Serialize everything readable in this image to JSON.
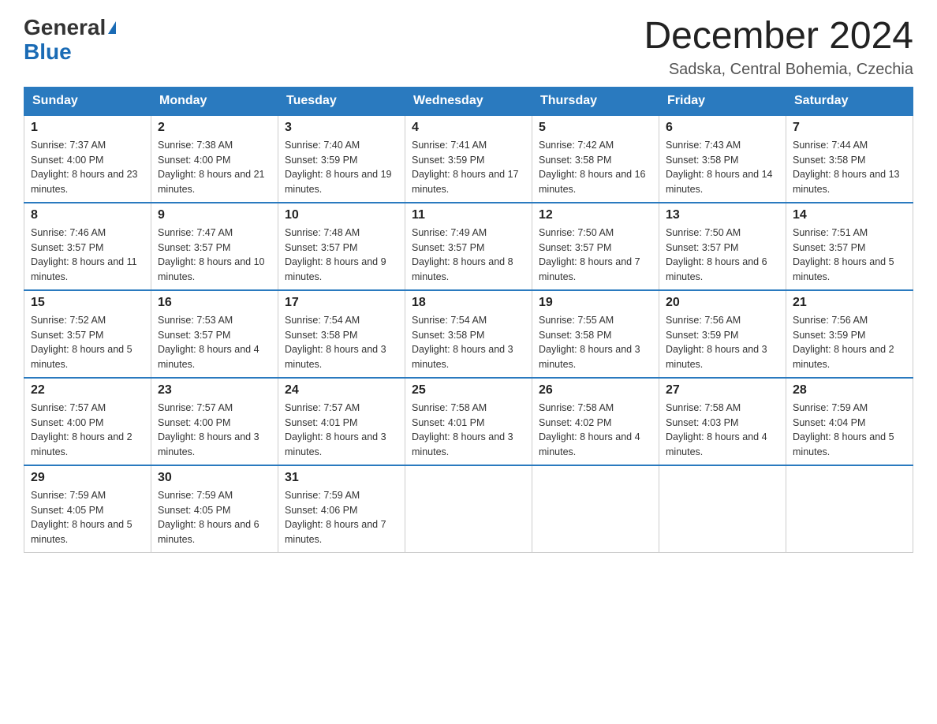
{
  "header": {
    "logo_general": "General",
    "logo_blue": "Blue",
    "month_title": "December 2024",
    "location": "Sadska, Central Bohemia, Czechia"
  },
  "weekdays": [
    "Sunday",
    "Monday",
    "Tuesday",
    "Wednesday",
    "Thursday",
    "Friday",
    "Saturday"
  ],
  "weeks": [
    [
      {
        "day": "1",
        "sunrise": "Sunrise: 7:37 AM",
        "sunset": "Sunset: 4:00 PM",
        "daylight": "Daylight: 8 hours and 23 minutes."
      },
      {
        "day": "2",
        "sunrise": "Sunrise: 7:38 AM",
        "sunset": "Sunset: 4:00 PM",
        "daylight": "Daylight: 8 hours and 21 minutes."
      },
      {
        "day": "3",
        "sunrise": "Sunrise: 7:40 AM",
        "sunset": "Sunset: 3:59 PM",
        "daylight": "Daylight: 8 hours and 19 minutes."
      },
      {
        "day": "4",
        "sunrise": "Sunrise: 7:41 AM",
        "sunset": "Sunset: 3:59 PM",
        "daylight": "Daylight: 8 hours and 17 minutes."
      },
      {
        "day": "5",
        "sunrise": "Sunrise: 7:42 AM",
        "sunset": "Sunset: 3:58 PM",
        "daylight": "Daylight: 8 hours and 16 minutes."
      },
      {
        "day": "6",
        "sunrise": "Sunrise: 7:43 AM",
        "sunset": "Sunset: 3:58 PM",
        "daylight": "Daylight: 8 hours and 14 minutes."
      },
      {
        "day": "7",
        "sunrise": "Sunrise: 7:44 AM",
        "sunset": "Sunset: 3:58 PM",
        "daylight": "Daylight: 8 hours and 13 minutes."
      }
    ],
    [
      {
        "day": "8",
        "sunrise": "Sunrise: 7:46 AM",
        "sunset": "Sunset: 3:57 PM",
        "daylight": "Daylight: 8 hours and 11 minutes."
      },
      {
        "day": "9",
        "sunrise": "Sunrise: 7:47 AM",
        "sunset": "Sunset: 3:57 PM",
        "daylight": "Daylight: 8 hours and 10 minutes."
      },
      {
        "day": "10",
        "sunrise": "Sunrise: 7:48 AM",
        "sunset": "Sunset: 3:57 PM",
        "daylight": "Daylight: 8 hours and 9 minutes."
      },
      {
        "day": "11",
        "sunrise": "Sunrise: 7:49 AM",
        "sunset": "Sunset: 3:57 PM",
        "daylight": "Daylight: 8 hours and 8 minutes."
      },
      {
        "day": "12",
        "sunrise": "Sunrise: 7:50 AM",
        "sunset": "Sunset: 3:57 PM",
        "daylight": "Daylight: 8 hours and 7 minutes."
      },
      {
        "day": "13",
        "sunrise": "Sunrise: 7:50 AM",
        "sunset": "Sunset: 3:57 PM",
        "daylight": "Daylight: 8 hours and 6 minutes."
      },
      {
        "day": "14",
        "sunrise": "Sunrise: 7:51 AM",
        "sunset": "Sunset: 3:57 PM",
        "daylight": "Daylight: 8 hours and 5 minutes."
      }
    ],
    [
      {
        "day": "15",
        "sunrise": "Sunrise: 7:52 AM",
        "sunset": "Sunset: 3:57 PM",
        "daylight": "Daylight: 8 hours and 5 minutes."
      },
      {
        "day": "16",
        "sunrise": "Sunrise: 7:53 AM",
        "sunset": "Sunset: 3:57 PM",
        "daylight": "Daylight: 8 hours and 4 minutes."
      },
      {
        "day": "17",
        "sunrise": "Sunrise: 7:54 AM",
        "sunset": "Sunset: 3:58 PM",
        "daylight": "Daylight: 8 hours and 3 minutes."
      },
      {
        "day": "18",
        "sunrise": "Sunrise: 7:54 AM",
        "sunset": "Sunset: 3:58 PM",
        "daylight": "Daylight: 8 hours and 3 minutes."
      },
      {
        "day": "19",
        "sunrise": "Sunrise: 7:55 AM",
        "sunset": "Sunset: 3:58 PM",
        "daylight": "Daylight: 8 hours and 3 minutes."
      },
      {
        "day": "20",
        "sunrise": "Sunrise: 7:56 AM",
        "sunset": "Sunset: 3:59 PM",
        "daylight": "Daylight: 8 hours and 3 minutes."
      },
      {
        "day": "21",
        "sunrise": "Sunrise: 7:56 AM",
        "sunset": "Sunset: 3:59 PM",
        "daylight": "Daylight: 8 hours and 2 minutes."
      }
    ],
    [
      {
        "day": "22",
        "sunrise": "Sunrise: 7:57 AM",
        "sunset": "Sunset: 4:00 PM",
        "daylight": "Daylight: 8 hours and 2 minutes."
      },
      {
        "day": "23",
        "sunrise": "Sunrise: 7:57 AM",
        "sunset": "Sunset: 4:00 PM",
        "daylight": "Daylight: 8 hours and 3 minutes."
      },
      {
        "day": "24",
        "sunrise": "Sunrise: 7:57 AM",
        "sunset": "Sunset: 4:01 PM",
        "daylight": "Daylight: 8 hours and 3 minutes."
      },
      {
        "day": "25",
        "sunrise": "Sunrise: 7:58 AM",
        "sunset": "Sunset: 4:01 PM",
        "daylight": "Daylight: 8 hours and 3 minutes."
      },
      {
        "day": "26",
        "sunrise": "Sunrise: 7:58 AM",
        "sunset": "Sunset: 4:02 PM",
        "daylight": "Daylight: 8 hours and 4 minutes."
      },
      {
        "day": "27",
        "sunrise": "Sunrise: 7:58 AM",
        "sunset": "Sunset: 4:03 PM",
        "daylight": "Daylight: 8 hours and 4 minutes."
      },
      {
        "day": "28",
        "sunrise": "Sunrise: 7:59 AM",
        "sunset": "Sunset: 4:04 PM",
        "daylight": "Daylight: 8 hours and 5 minutes."
      }
    ],
    [
      {
        "day": "29",
        "sunrise": "Sunrise: 7:59 AM",
        "sunset": "Sunset: 4:05 PM",
        "daylight": "Daylight: 8 hours and 5 minutes."
      },
      {
        "day": "30",
        "sunrise": "Sunrise: 7:59 AM",
        "sunset": "Sunset: 4:05 PM",
        "daylight": "Daylight: 8 hours and 6 minutes."
      },
      {
        "day": "31",
        "sunrise": "Sunrise: 7:59 AM",
        "sunset": "Sunset: 4:06 PM",
        "daylight": "Daylight: 8 hours and 7 minutes."
      },
      null,
      null,
      null,
      null
    ]
  ]
}
